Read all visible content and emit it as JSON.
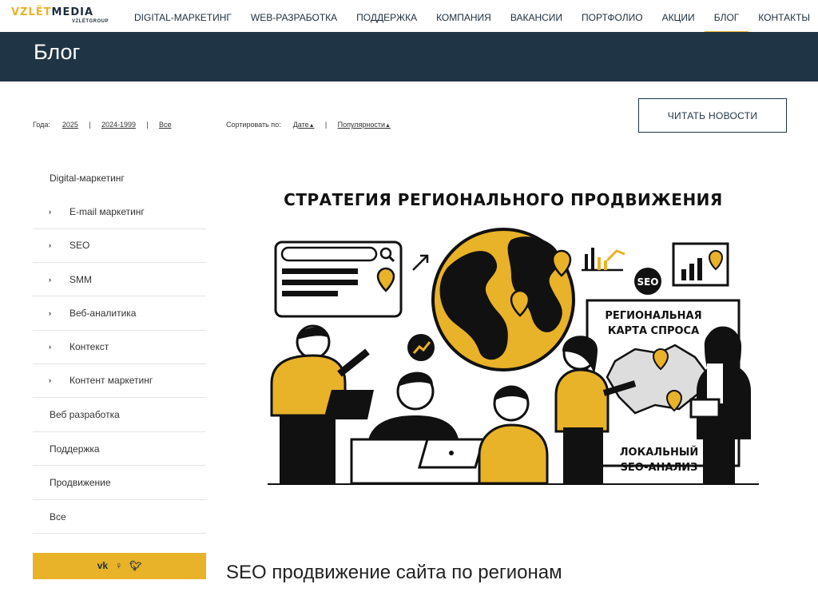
{
  "logo": {
    "part1": "VZLЁТ",
    "part2": "MEDIA",
    "sub": "VZLЁTGROUP"
  },
  "nav": [
    {
      "label": "DIGITAL-МАРКЕТИНГ",
      "active": false
    },
    {
      "label": "WEB-РАЗРАБОТКА",
      "active": false
    },
    {
      "label": "ПОДДЕРЖКА",
      "active": false
    },
    {
      "label": "КОМПАНИЯ",
      "active": false
    },
    {
      "label": "ВАКАНСИИ",
      "active": false
    },
    {
      "label": "ПОРТФОЛИО",
      "active": false
    },
    {
      "label": "АКЦИИ",
      "active": false
    },
    {
      "label": "БЛОГ",
      "active": true
    },
    {
      "label": "КОНТАКТЫ",
      "active": false
    }
  ],
  "page_title": "Блог",
  "filters": {
    "label": "Года:",
    "options": [
      "2025",
      "2024-1999",
      "Все"
    ]
  },
  "sort": {
    "label": "Сортировать по:",
    "options": [
      "Дате",
      "Популярности"
    ]
  },
  "read_news_button": "ЧИТАТЬ НОВОСТИ",
  "sidebar": {
    "top": "Digital-маркетинг",
    "subs": [
      "E-mail маркетинг",
      "SEO",
      "SMM",
      "Веб-аналитика",
      "Контекст",
      "Контент маркетинг"
    ],
    "cats": [
      "Веб разработка",
      "Поддержка",
      "Продвижение",
      "Все"
    ]
  },
  "social": [
    "vk-icon",
    "odnoklassniki-icon",
    "twitter-icon"
  ],
  "illustration": {
    "title": "СТРАТЕГИЯ РЕГИОНАЛЬНОГО ПРОДВИЖЕНИЯ",
    "board_line1": "РЕГИОНАЛЬНАЯ",
    "board_line2": "КАРТА СПРОСА",
    "seo_badge": "SEO",
    "local_line1": "ЛОКАЛЬНЫЙ",
    "local_line2": "SEO-АНАЛИЗ"
  },
  "post_title": "SEO продвижение сайта по регионам",
  "colors": {
    "accent": "#e8b229",
    "navy": "#1f3444"
  }
}
